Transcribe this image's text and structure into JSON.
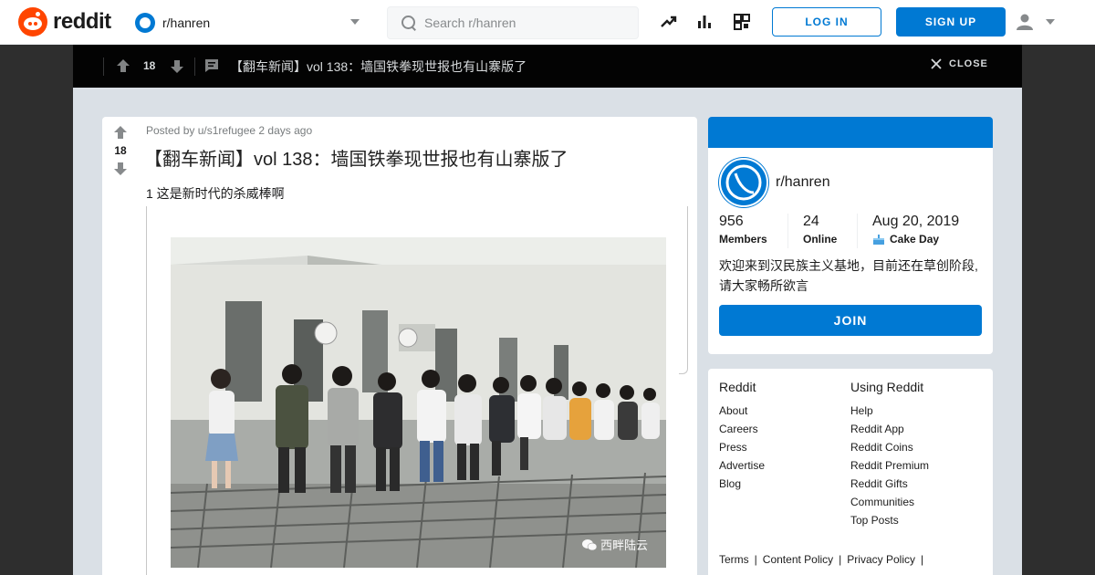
{
  "header": {
    "logo_text": "reddit",
    "community": "r/hanren",
    "search_placeholder": "Search r/hanren",
    "login_label": "LOG IN",
    "signup_label": "SIGN UP"
  },
  "postbar": {
    "vote_count": "18",
    "title": "【翻车新闻】vol 138：墙国铁拳现世报也有山寨版了",
    "close_label": "CLOSE"
  },
  "post": {
    "vote_count": "18",
    "meta": "Posted by u/s1refugee 2 days ago",
    "title": "【翻车新闻】vol 138：墙国铁拳现世报也有山寨版了",
    "body": "1 这是新时代的杀威棒啊",
    "image_watermark": "西畔陆云"
  },
  "sidebar": {
    "sub_name": "r/hanren",
    "members_count": "956",
    "members_label": "Members",
    "online_count": "24",
    "online_label": "Online",
    "cake_date": "Aug 20, 2019",
    "cake_label": "Cake Day",
    "description": "欢迎来到汉民族主义基地，目前还在草创阶段,请大家畅所欲言",
    "join_label": "JOIN"
  },
  "footer_links": {
    "col1_title": "Reddit",
    "col1": [
      "About",
      "Careers",
      "Press",
      "Advertise",
      "Blog"
    ],
    "col2_title": "Using Reddit",
    "col2": [
      "Help",
      "Reddit App",
      "Reddit Coins",
      "Reddit Premium",
      "Reddit Gifts",
      "Communities",
      "Top Posts"
    ],
    "legal": [
      "Terms",
      "Content Policy",
      "Privacy Policy"
    ]
  },
  "colors": {
    "brand": "#ff4500",
    "accent": "#0079d3",
    "overlay": "#030303",
    "canvas": "#dae0e6"
  }
}
